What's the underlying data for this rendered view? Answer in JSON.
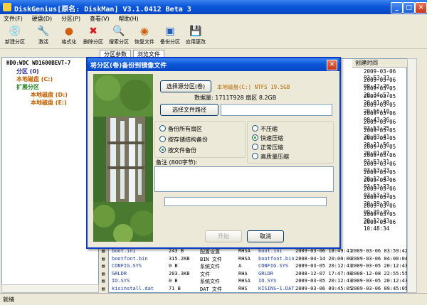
{
  "window": {
    "title": "DiskGenius[原名: DiskMan] V3.1.0412 Beta 3"
  },
  "menu": [
    "文件(F)",
    "硬盘(D)",
    "分区(P)",
    "查看(V)",
    "帮助(H)"
  ],
  "toolbar": [
    {
      "label": "新建分区",
      "icon": "new-partition-icon"
    },
    {
      "label": "激活",
      "icon": "activate-icon"
    },
    {
      "label": "格式化",
      "icon": "format-icon"
    },
    {
      "label": "删除分区",
      "icon": "delete-icon"
    },
    {
      "label": "搜索分区",
      "icon": "search-partition-icon"
    },
    {
      "label": "恢复文件",
      "icon": "recover-file-icon"
    },
    {
      "label": "备份分区",
      "icon": "backup-icon"
    },
    {
      "label": "应用更改",
      "icon": "apply-icon"
    }
  ],
  "tree": {
    "disk": "HD0:WDC WD1600BEVT-7",
    "items": [
      "分区 (0)",
      "本地磁盘 (C:)",
      "扩展分区",
      "本地磁盘 (D:)",
      "本地磁盘 (E:)"
    ]
  },
  "tabs": [
    "分区参数",
    "浏览文件"
  ],
  "filelist": {
    "col_created": "创建时间",
    "created_times": [
      "2009-03-06 03:53:23",
      "2009-03-06 09:42:26",
      "2009-03-05 20:34:57",
      "2009-03-05 20:01:08",
      "2009-03-05 20:56:10",
      "2009-03-06 09:43:26",
      "2009-03-06 03:53:25",
      "2009-03-05 20:03:41",
      "2009-03-05 20:21:56",
      "2009-03-05 20:01:07",
      "2009-03-06 03:53:31",
      "2009-03-06 03:53:23",
      "2009-03-05 20:12:43",
      "2009-03-06 03:53:23",
      "2009-03-06 03:53:23",
      "2009-03-05 20:39:30",
      "2009-03-06 09:39:39",
      "2009-03-05 20:12:43",
      "2009-03-06 10:48:34"
    ],
    "rows": [
      {
        "name": "boot.ini",
        "size": "243 B",
        "type": "配置设置",
        "attr": "RHSA",
        "short": "boot.ini",
        "modified": "2009-03-06 18:49:41",
        "created": "2009-03-06 03:59:42"
      },
      {
        "name": "bootfont.bin",
        "size": "315.2KB",
        "type": "BIN 文件",
        "attr": "RHSA",
        "short": "bootfont.bin",
        "modified": "2008-04-14 20:00:00",
        "created": "2009-03-06 04:00:04"
      },
      {
        "name": "CONFIG.SYS",
        "size": "0 B",
        "type": "系统文件",
        "attr": "A",
        "short": "CONFIG.SYS",
        "modified": "2009-03-05 20:12:43",
        "created": "2009-03-05 20:12:43"
      },
      {
        "name": "GRLDR",
        "size": "203.3KB",
        "type": "文件",
        "attr": "RHA",
        "short": "GRLDR",
        "modified": "2008-12-07 17:47:48",
        "created": "2008-12-08 22:55:55"
      },
      {
        "name": "IO.SYS",
        "size": "0 B",
        "type": "系统文件",
        "attr": "RHSA",
        "short": "IO.SYS",
        "modified": "2009-03-05 20:12:43",
        "created": "2009-03-05 20:12:43"
      },
      {
        "name": "kisinstall.dat",
        "size": "71 B",
        "type": "DAT 文件",
        "attr": "RHS",
        "short": "KISINS~1.DAT",
        "modified": "2009-03-06 09:45:05",
        "created": "2009-03-06 09:45:05"
      }
    ]
  },
  "status": "就绪",
  "dialog": {
    "title": "将分区(卷)备份到镜像文件",
    "select_partition_button": "选择源分区(卷)",
    "partition_info": "本地磁盘(C:) NTFS 19.5GB",
    "data_size": "数据量: 1711T928 扇区  8.2GB",
    "select_path_button": "选择文件路径",
    "backup_options": [
      "备份所有扇区",
      "按存储结构备份",
      "按文件备份"
    ],
    "backup_selected": 2,
    "compression_options": [
      "不压缩",
      "快速压缩",
      "正常压缩",
      "高质量压缩"
    ],
    "compression_selected": 1,
    "notes_label": "备注 (800字节):",
    "start_button": "开始",
    "cancel_button": "取消"
  }
}
